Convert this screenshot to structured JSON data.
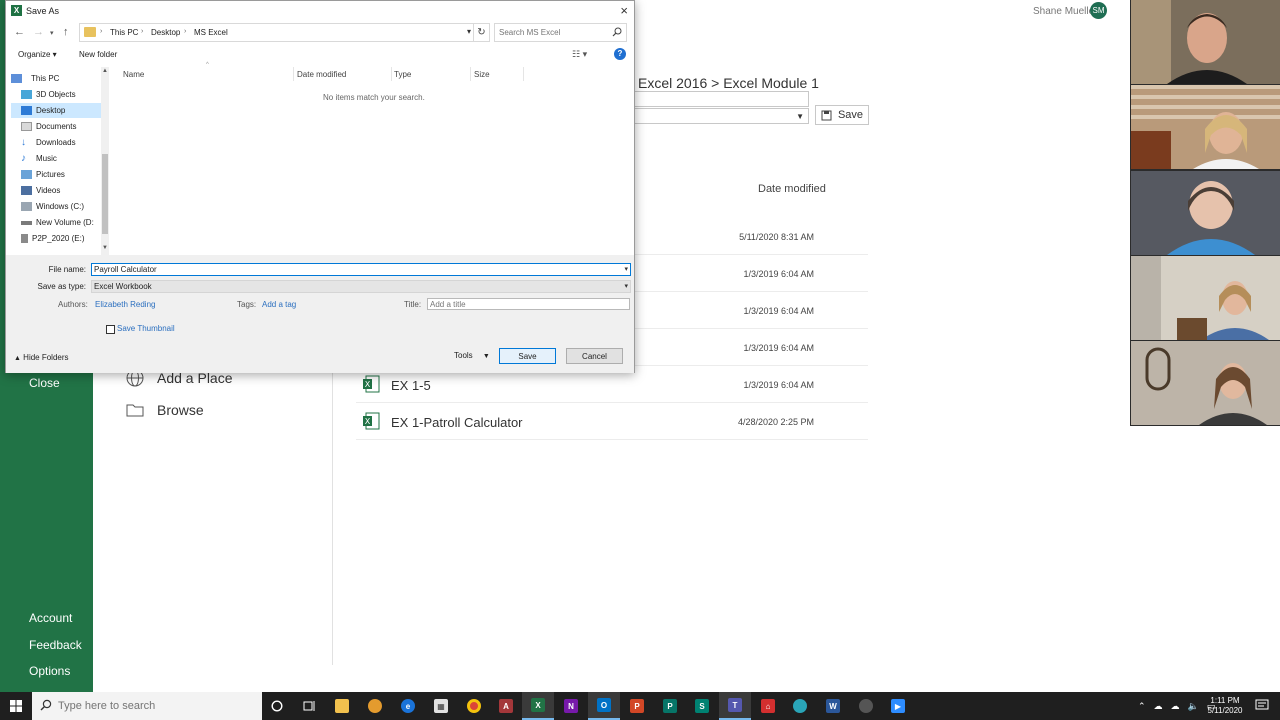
{
  "dialog": {
    "title": "Save As",
    "close": "×",
    "address": {
      "crumbs": [
        "This PC",
        "Desktop",
        "MS Excel"
      ]
    },
    "search_placeholder": "Search MS Excel",
    "toolbar": {
      "organize": "Organize ▾",
      "new_folder": "New folder"
    },
    "nav_items": [
      "This PC",
      "3D Objects",
      "Desktop",
      "Documents",
      "Downloads",
      "Music",
      "Pictures",
      "Videos",
      "Windows (C:)",
      "New Volume (D:",
      "P2P_2020 (E:)"
    ],
    "columns": [
      "Name",
      "Date modified",
      "Type",
      "Size"
    ],
    "empty_message": "No items match your search.",
    "file_name_label": "File name:",
    "file_name_value": "Payroll Calculator",
    "save_type_label": "Save as type:",
    "save_type_value": "Excel Workbook",
    "authors_label": "Authors:",
    "authors_value": "Elizabeth Reding",
    "tags_label": "Tags:",
    "tags_value": "Add a tag",
    "title_label": "Title:",
    "title_placeholder": "Add a title",
    "save_thumbnail_label": "Save Thumbnail",
    "hide_folders": "Hide Folders",
    "tools": "Tools",
    "save_button": "Save",
    "cancel_button": "Cancel"
  },
  "backstage": {
    "sidebar_items": {
      "close": "Close",
      "account": "Account",
      "feedback": "Feedback",
      "options": "Options"
    },
    "places": [
      "Add a Place",
      "Browse"
    ],
    "breadcrumb": "Excel 2016 > Excel Module 1",
    "save_button": "Save",
    "date_header": "Date modified",
    "files": [
      {
        "name": "",
        "date": "5/11/2020 8:31 AM"
      },
      {
        "name": "",
        "date": "1/3/2019 6:04 AM"
      },
      {
        "name": "",
        "date": "1/3/2019 6:04 AM"
      },
      {
        "name": "",
        "date": "1/3/2019 6:04 AM"
      },
      {
        "name": "EX 1-5",
        "date": "1/3/2019 6:04 AM"
      },
      {
        "name": "EX 1-Patroll Calculator",
        "date": "4/28/2020 2:25 PM"
      }
    ],
    "user_name": "Shane Mueller",
    "user_initials": "SM"
  },
  "taskbar": {
    "search_placeholder": "Type here to search",
    "time": "1:11 PM",
    "date": "5/11/2020"
  },
  "colors": {
    "excel_green": "#217346",
    "accent_blue": "#0078d7",
    "taskbar": "#1f1f1f"
  }
}
